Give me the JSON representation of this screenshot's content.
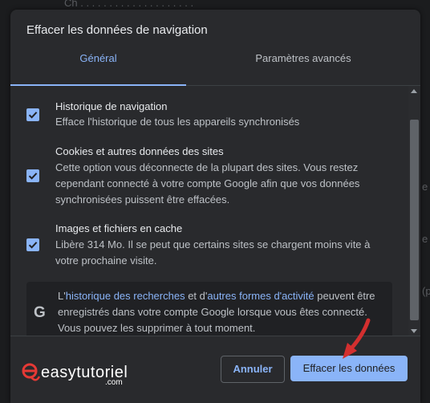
{
  "colors": {
    "accent": "#8ab4f8",
    "dialog_bg": "#292a2d",
    "logo_red": "#e53935",
    "arrow_red": "#d32f2f"
  },
  "dialog": {
    "title": "Effacer les données de navigation"
  },
  "tabs": [
    {
      "label": "Général",
      "selected": true
    },
    {
      "label": "Paramètres avancés",
      "selected": false
    }
  ],
  "items": [
    {
      "title": "Historique de navigation",
      "desc": "Efface l'historique de tous les appareils synchronisés",
      "checked": true
    },
    {
      "title": "Cookies et autres données des sites",
      "desc": "Cette option vous déconnecte de la plupart des sites. Vous restez cependant connecté à votre compte Google afin que vos données synchronisées puissent être effacées.",
      "checked": true
    },
    {
      "title": "Images et fichiers en cache",
      "desc": "Libère 314 Mo. Il se peut que certains sites se chargent moins vite à votre prochaine visite.",
      "checked": true
    }
  ],
  "info": {
    "icon": "google-g-icon",
    "prefix": "L'",
    "link1": "historique des recherches",
    "mid": " et d'",
    "link2": "autres formes d'activité",
    "suffix": " peuvent être enregistrés dans votre compte Google lorsque vous êtes connecté. Vous pouvez les supprimer à tout moment."
  },
  "footer": {
    "logo_text": "easytutoriel",
    "logo_com": ".com",
    "cancel_label": "Annuler",
    "clear_label": "Effacer les données"
  }
}
